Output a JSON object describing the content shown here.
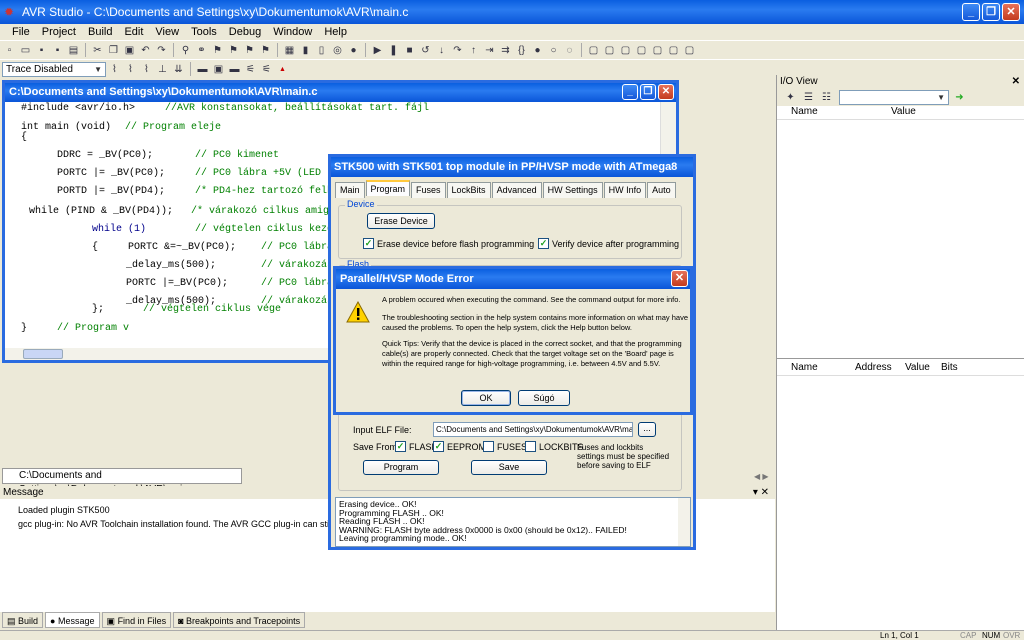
{
  "app": {
    "title": "AVR Studio - C:\\Documents and Settings\\xy\\Dokumentumok\\AVR\\main.c"
  },
  "menu": [
    "File",
    "Project",
    "Build",
    "Edit",
    "View",
    "Tools",
    "Debug",
    "Window",
    "Help"
  ],
  "toolbar2": {
    "trace_combo": "Trace Disabled"
  },
  "editor": {
    "title": "C:\\Documents and Settings\\xy\\Dokumentumok\\AVR\\main.c",
    "lines": [
      {
        "code": "#include <avr/io.h>",
        "comment": "//AVR konstansokat, beállításokat tart. fájl"
      },
      {
        "code": "int main (void)",
        "comment": "// Program eleje"
      },
      {
        "code": "{",
        "comment": ""
      },
      {
        "code": "DDRC = _BV(PC0);",
        "comment": "// PC0 kimenet"
      },
      {
        "code": "PORTC |= _BV(PC0);",
        "comment": "// PC0 lábra +5V (LED ki"
      },
      {
        "code": "PORTD |= _BV(PD4);",
        "comment": "/* PD4-hez tartozó felhú"
      },
      {
        "code": "while (PIND & _BV(PD4));",
        "comment": "/* várakozó cilkus amig P"
      },
      {
        "code": "while (1)",
        "comment": "// végtelen ciklus kezde"
      },
      {
        "code": "{     PORTC &=~_BV(PC0);",
        "comment": "// PC0 lábra"
      },
      {
        "code": "_delay_ms(500);",
        "comment": "// várakozás"
      },
      {
        "code": "PORTC |=_BV(PC0);",
        "comment": "// PC0 lábra"
      },
      {
        "code": "_delay_ms(500);",
        "comment": "// várakozás"
      },
      {
        "code": "};",
        "comment": "// végtelen ciklus vége"
      },
      {
        "code": "}",
        "comment": "// Program v"
      }
    ]
  },
  "doc_tab": "C:\\Documents and Settings\\xy\\Dokumentumok\\AVR\\main.c",
  "io_view": {
    "title": "I/O View",
    "cols1": [
      "Name",
      "Value"
    ],
    "cols2": [
      "Name",
      "Address",
      "Value",
      "Bits"
    ]
  },
  "message": {
    "title": "Message",
    "lines": [
      "Loaded plugin STK500",
      "gcc plug-in: No AVR Toolchain installation found. The AVR GCC plug-in can still be used if you"
    ]
  },
  "bottom_tabs": [
    "Build",
    "Message",
    "Find in Files",
    "Breakpoints and Tracepoints"
  ],
  "status": {
    "pos": "Ln 1, Col 1",
    "caps": "CAP",
    "num": "NUM",
    "ovr": "OVR"
  },
  "stk": {
    "title": "STK500 with STK501 top module in PP/HVSP mode with ATmega8",
    "tabs": [
      "Main",
      "Program",
      "Fuses",
      "LockBits",
      "Advanced",
      "HW Settings",
      "HW Info",
      "Auto"
    ],
    "device_group": "Device",
    "erase_button": "Erase Device",
    "erase_check": "Erase device before flash programming",
    "verify_check": "Verify device after programming",
    "flash_group": "Flash",
    "elf_label": "Input ELF File:",
    "elf_value": "C:\\Documents and Settings\\xy\\Dokumentumok\\AVR\\ma",
    "browse": "...",
    "save_from": "Save From:",
    "opt_flash": "FLASH",
    "opt_eeprom": "EEPROM",
    "opt_fuses": "FUSES",
    "opt_lockbits": "LOCKBITS",
    "note": "Fuses and lockbits settings must be specified before saving to ELF",
    "program_btn": "Program",
    "save_btn": "Save",
    "log": [
      "Erasing device.. OK!",
      "Programming FLASH ..     OK!",
      "Reading FLASH ..     OK!",
      "WARNING: FLASH byte address 0x0000 is 0x00 (should be 0x12).. FAILED!",
      "Leaving programming mode.. OK!"
    ]
  },
  "error": {
    "title": "Parallel/HVSP Mode Error",
    "p1": "A problem occured when executing the command. See the command output for more info.",
    "p2": "The troubleshooting section in the help system contains more information on what may have caused the problems. To open the help system, click the Help button below.",
    "p3": "Quick Tips: Verify that the device is placed in the correct socket, and that the programming cable(s) are properly connected. Check that the target voltage set on the 'Board' page is within the required range for high-voltage programming, i.e. between 4.5V and 5.5V.",
    "ok": "OK",
    "help": "Súgó"
  }
}
